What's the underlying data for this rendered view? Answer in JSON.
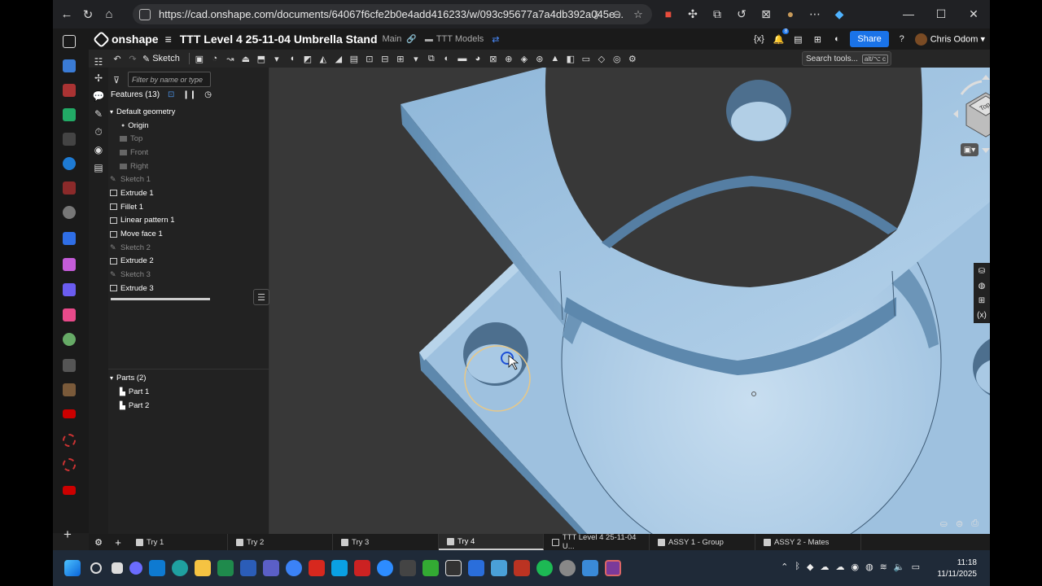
{
  "browser": {
    "url": "https://cad.onshape.com/documents/64067f6cfe2b0e4add416233/w/093c95677a7a4db392a045e...",
    "window_controls": [
      "—",
      "☐",
      "✕"
    ]
  },
  "onshape": {
    "logo": "onshape",
    "title": "TTT Level 4 25-11-04 Umbrella Stand",
    "branch": "Main",
    "folder": "TTT Models",
    "share_label": "Share",
    "user_name": "Chris Odom",
    "notifications": "8"
  },
  "toolbar": {
    "sketch_label": "Sketch",
    "search_label": "Search tools...",
    "search_shortcut": "alt/⌥ c"
  },
  "feature_tree": {
    "filter_placeholder": "Filter by name or type",
    "header": "Features (13)",
    "items": [
      {
        "label": "Default geometry"
      },
      {
        "label": "Origin"
      },
      {
        "label": "Top"
      },
      {
        "label": "Front"
      },
      {
        "label": "Right"
      },
      {
        "label": "Sketch 1"
      },
      {
        "label": "Extrude 1"
      },
      {
        "label": "Fillet 1"
      },
      {
        "label": "Linear pattern 1"
      },
      {
        "label": "Move face 1"
      },
      {
        "label": "Sketch 2"
      },
      {
        "label": "Extrude 2"
      },
      {
        "label": "Sketch 3"
      },
      {
        "label": "Extrude 3"
      }
    ],
    "parts_header": "Parts (2)",
    "parts": [
      "Part 1",
      "Part 2"
    ]
  },
  "viewport": {
    "view_cube_label": "Top"
  },
  "tabs": [
    {
      "label": "Try 1"
    },
    {
      "label": "Try 2"
    },
    {
      "label": "Try 3"
    },
    {
      "label": "Try 4"
    },
    {
      "label": "TTT Level 4 25-11-04 U..."
    },
    {
      "label": "ASSY 1 - Group"
    },
    {
      "label": "ASSY 2 - Mates"
    }
  ],
  "taskbar": {
    "time": "11:18",
    "date": "11/11/2025"
  }
}
